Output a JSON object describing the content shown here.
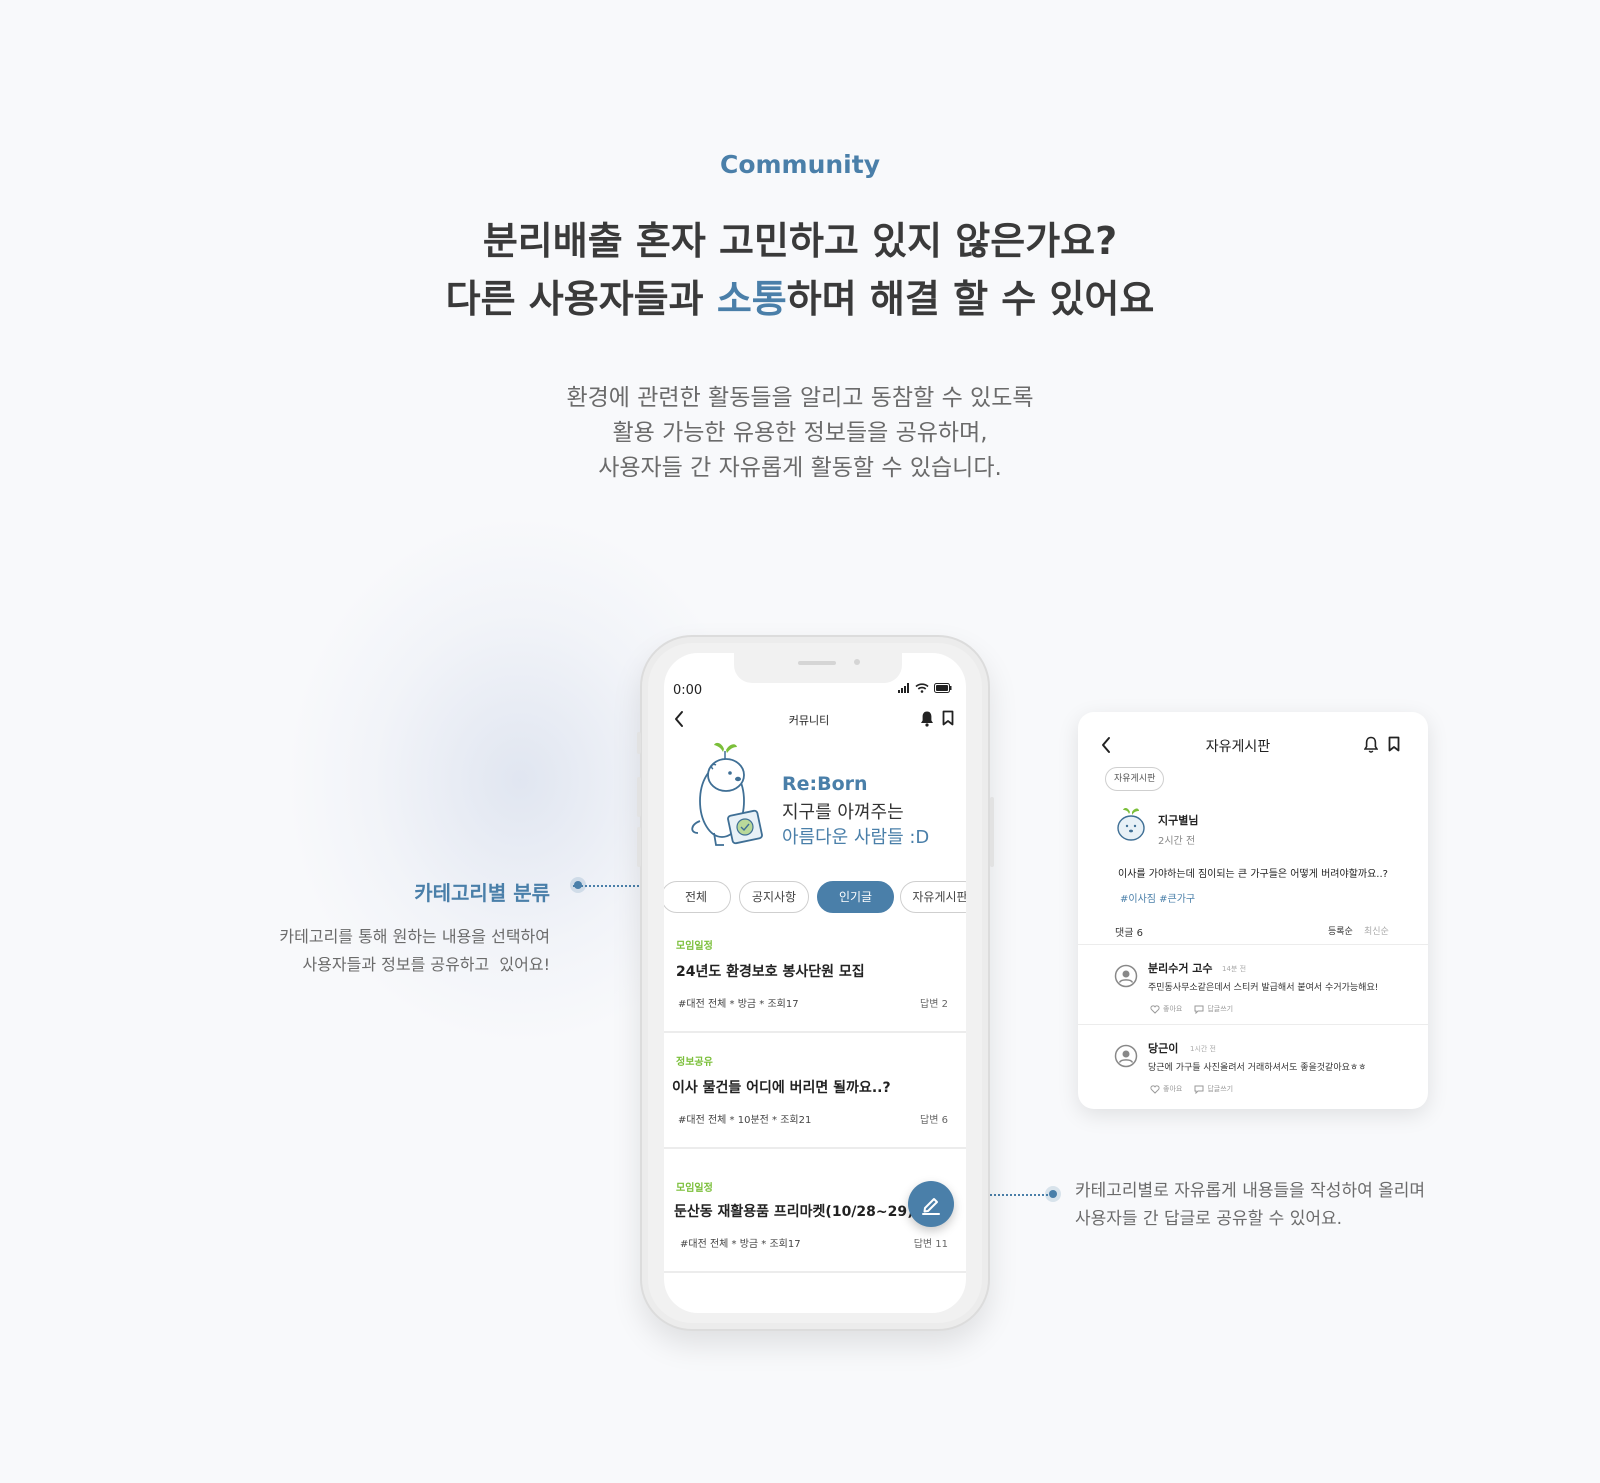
{
  "section": {
    "label": "Community",
    "headline_line1": "분리배출 혼자 고민하고 있지 않은가요?",
    "headline_line2_pre": "다른 사용자들과 ",
    "headline_line2_accent": "소통",
    "headline_line2_post": "하며 해결 할 수 있어요",
    "desc_line1": "환경에 관련한 활동들을 알리고 동참할 수 있도록",
    "desc_line2": "활용 가능한 유용한 정보들을 공유하며,",
    "desc_line3": "사용자들 간 자유롭게 활동할 수 있습니다."
  },
  "left_note": {
    "title": "카테고리별 분류",
    "line1": "카테고리를 통해 원하는 내용을 선택하여",
    "line2": "사용자들과 정보를 공유하고  있어요!"
  },
  "right_note": {
    "line1": "카테고리별로 자유롭게 내용들을 작성하여 올리며",
    "line2": "사용자들 간 답글로 공유할 수 있어요."
  },
  "phone": {
    "status_time": "0:00",
    "title": "커뮤니티",
    "hero": {
      "line1": "Re:Born",
      "line2": "지구를 아껴주는",
      "line3": "아름다운 사람들 :D"
    },
    "chips": [
      "전체",
      "공지사항",
      "인기글",
      "자유게시판"
    ],
    "active_chip": "인기글",
    "posts": [
      {
        "category": "모임일정",
        "title": "24년도 환경보호 봉사단원 모집",
        "meta": "#대전 전체 * 방금 * 조회17",
        "answers": "답변 2"
      },
      {
        "category": "정보공유",
        "title": "이사 물건들 어디에 버리면 될까요..?",
        "meta": "#대전 전체 * 10분전 * 조회21",
        "answers": "답변 6"
      },
      {
        "category": "모임일정",
        "title": "둔산동 재활용품 프리마켓(10/28~29)",
        "meta": "#대전 전체 * 방금 * 조회17",
        "answers": "답변 11"
      }
    ]
  },
  "card": {
    "title": "자유게시판",
    "tag": "자유게시판",
    "author": "지구별님",
    "time": "2시간 전",
    "body": "이사를 가야하는데 짐이되는 큰 가구들은 어떻게 버려야할까요..?",
    "tags": "#이사짐 #큰가구",
    "comment_count": "댓글 6",
    "sort_registered": "등록순",
    "sort_latest": "최신순",
    "comments": [
      {
        "name": "분리수거 고수",
        "ago": "14분 전",
        "text": "주민동사무소같은데서 스티커 발급해서 붙여서 수거가능해요!",
        "like": "좋아요",
        "reply": "답글쓰기"
      },
      {
        "name": "당근이",
        "ago": "1시간 전",
        "text": "당근에 가구들 사진올려서 거래하셔서도 좋을것같아요ㅎㅎ",
        "like": "좋아요",
        "reply": "답글쓰기"
      }
    ]
  },
  "colors": {
    "accent": "#4a7fa9",
    "category": "#7bbf3a",
    "background": "#f8f9fb"
  }
}
